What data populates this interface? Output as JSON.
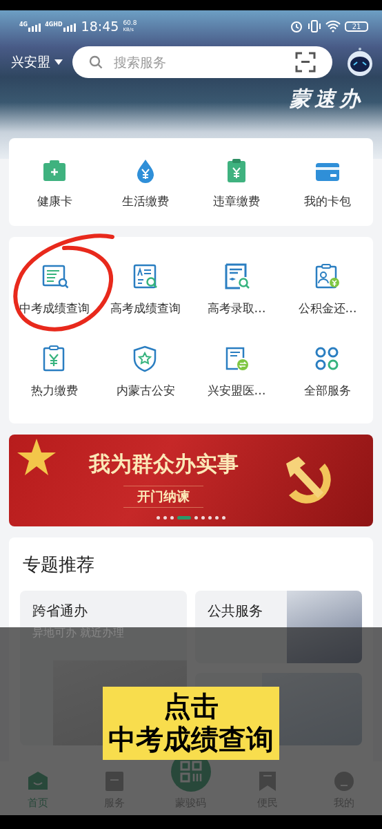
{
  "status_bar": {
    "network_1": "4G",
    "network_2": "4GHD",
    "time": "18:45",
    "speed": "60.8",
    "speed_unit": "KB/s",
    "battery": "21"
  },
  "header": {
    "region": "兴安盟",
    "search": {
      "placeholder": "搜索服务"
    },
    "logo_text": "蒙速办"
  },
  "quick_services": [
    {
      "label": "健康卡"
    },
    {
      "label": "生活缴费"
    },
    {
      "label": "违章缴费"
    },
    {
      "label": "我的卡包"
    }
  ],
  "services": [
    {
      "label": "中考成绩查询",
      "circled": true
    },
    {
      "label": "高考成绩查询",
      "circled": false
    },
    {
      "label": "高考录取…",
      "circled": false
    },
    {
      "label": "公积金还…",
      "circled": false
    },
    {
      "label": "热力缴费",
      "circled": false
    },
    {
      "label": "内蒙古公安",
      "circled": false
    },
    {
      "label": "兴安盟医…",
      "circled": false
    },
    {
      "label": "全部服务",
      "circled": false
    }
  ],
  "banner": {
    "title": "我为群众办实事",
    "subtitle": "开门纳谏",
    "dots": [
      {
        "selected": false
      },
      {
        "selected": false
      },
      {
        "selected": false
      },
      {
        "selected": true
      },
      {
        "selected": false
      },
      {
        "selected": false
      },
      {
        "selected": false
      },
      {
        "selected": false
      },
      {
        "selected": false
      }
    ]
  },
  "topics": {
    "title": "专题推荐",
    "cards": [
      {
        "kind": "text",
        "title": "跨省通办",
        "subtitle": "异地可办 就近办理"
      },
      {
        "kind": "text",
        "title": "公共服务"
      },
      {
        "kind": "photo"
      }
    ]
  },
  "caption": {
    "lines": [
      "点击",
      "中考成绩查询"
    ]
  },
  "tab_bar": [
    {
      "label": "首页",
      "selected": true
    },
    {
      "label": "服务",
      "selected": false
    },
    {
      "label": "蒙骏码",
      "selected": false
    },
    {
      "label": "便民",
      "selected": false
    },
    {
      "label": "我的",
      "selected": false
    }
  ]
}
